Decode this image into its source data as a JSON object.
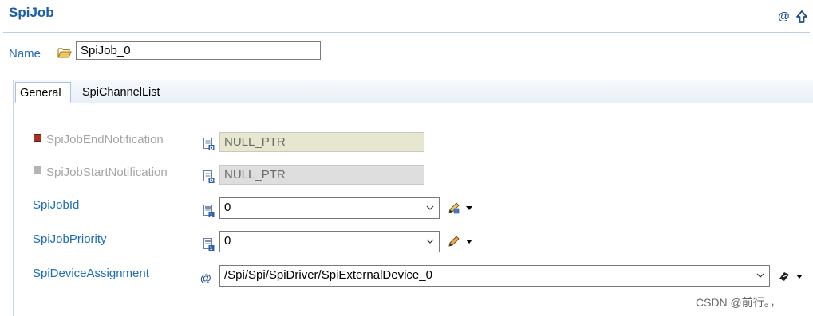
{
  "header": {
    "title": "SpiJob",
    "at_icon": "@",
    "up_icon": "arrow-up-icon"
  },
  "name_row": {
    "label": "Name",
    "value": "SpiJob_0",
    "icon": "folder-open-icon"
  },
  "tabs": [
    {
      "label": "General",
      "active": true
    },
    {
      "label": "SpiChannelList",
      "active": false
    }
  ],
  "fields": [
    {
      "label": "SpiJobEndNotification",
      "value": "NULL_PTR",
      "enabled": false,
      "marker_color": "#a83222"
    },
    {
      "label": "SpiJobStartNotification",
      "value": "NULL_PTR",
      "enabled": false,
      "marker_color": "#b4b4b4"
    },
    {
      "label": "SpiJobId",
      "value": "0",
      "enabled": true
    },
    {
      "label": "SpiJobPriority",
      "value": "0",
      "enabled": true
    },
    {
      "label": "SpiDeviceAssignment",
      "value": "/Spi/Spi/SpiDriver/SpiExternalDevice_0",
      "enabled": true,
      "icon_text": "@"
    }
  ],
  "watermark": "CSDN @前行。，",
  "colors": {
    "accent": "#1d6cb8",
    "title": "#1c5fa8"
  }
}
